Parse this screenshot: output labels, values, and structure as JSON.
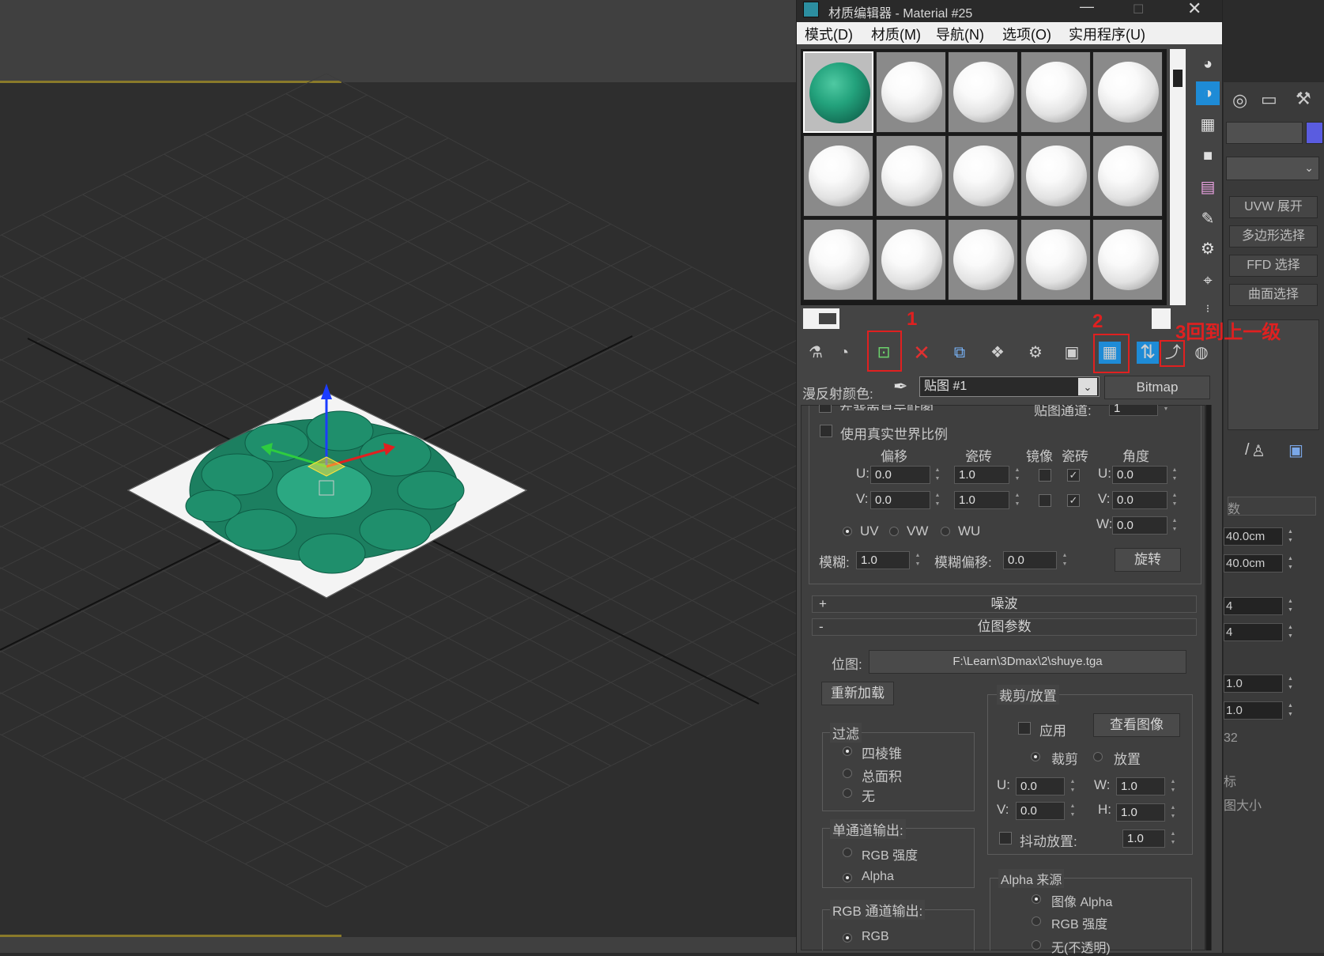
{
  "window": {
    "title": "材质编辑器 - Material #25"
  },
  "menu": [
    "模式(D)",
    "材质(M)",
    "导航(N)",
    "选项(O)",
    "实用程序(U)"
  ],
  "annotations": {
    "mark1": "1",
    "mark2": "2",
    "mark3": "3回到上一级"
  },
  "map_row": {
    "label": "漫反射颜色:",
    "map_name": "贴图 #1",
    "map_type": "Bitmap"
  },
  "coords": {
    "partial_checkbox": "在背面显示贴图",
    "map_channel_label": "贴图通道:",
    "map_channel_value": "1",
    "real_world_label": "使用真实世界比例",
    "col_offset": "偏移",
    "col_tiling": "瓷砖",
    "col_mirror": "镜像",
    "col_tile": "瓷砖",
    "col_angle": "角度",
    "u_label": "U:",
    "v_label": "V:",
    "w_label": "W:",
    "u_offset": "0.0",
    "v_offset": "0.0",
    "u_tiling": "1.0",
    "v_tiling": "1.0",
    "u_angle": "0.0",
    "v_angle": "0.0",
    "w_angle": "0.0",
    "uv": "UV",
    "vw": "VW",
    "wu": "WU",
    "blur_label": "模糊:",
    "blur_value": "1.0",
    "blur_offset_label": "模糊偏移:",
    "blur_offset_value": "0.0",
    "rotate_button": "旋转"
  },
  "rollouts": {
    "noise": "噪波",
    "bitmap_params": "位图参数",
    "noise_sign": "+",
    "bitmap_sign": "-"
  },
  "bitmap": {
    "bitmap_label": "位图:",
    "path": "F:\\Learn\\3Dmax\\2\\shuye.tga",
    "reload": "重新加载",
    "filter_group": "过滤",
    "filter_options": [
      "四棱锥",
      "总面积",
      "无"
    ],
    "mono_group": "单通道输出:",
    "mono_options": [
      "RGB 强度",
      "Alpha"
    ],
    "rgb_group": "RGB 通道输出:",
    "rgb_options": [
      "RGB"
    ],
    "crop_group": "裁剪/放置",
    "apply": "应用",
    "view_image": "查看图像",
    "crop": "裁剪",
    "place": "放置",
    "u_label": "U:",
    "v_label": "V:",
    "w_label": "W:",
    "h_label": "H:",
    "u": "0.0",
    "v": "0.0",
    "w": "1.0",
    "h": "1.0",
    "jitter_label": "抖动放置:",
    "jitter": "1.0",
    "alpha_group": "Alpha 来源",
    "alpha_options": [
      "图像 Alpha",
      "RGB 强度",
      "无(不透明)"
    ]
  },
  "right_panel": {
    "buttons": [
      "UVW 展开",
      "多边形选择",
      "FFD 选择",
      "曲面选择"
    ],
    "section_label": "数",
    "fields": [
      "40.0cm",
      "40.0cm",
      "4",
      "4",
      "1.0",
      "1.0"
    ],
    "fragment_32": "32",
    "fragment_label1": "标",
    "fragment_label2": "图大小"
  },
  "colors": {
    "accent_red": "#e02020",
    "active_blue": "#1e8bd6",
    "swatch": "#5a5ce0"
  }
}
